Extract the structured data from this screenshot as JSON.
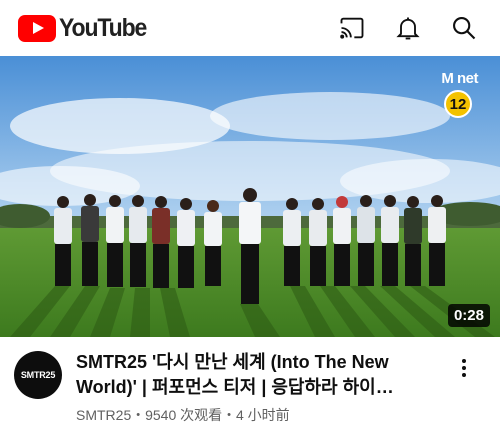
{
  "header": {
    "logo_text": "YouTube",
    "icons": [
      "cast-icon",
      "notifications-icon",
      "search-icon"
    ]
  },
  "video": {
    "channel_watermark": "M net",
    "age_rating": "12",
    "duration": "0:28"
  },
  "info": {
    "avatar_text": "SMTR25",
    "title_line1": "SMTR25 '다시 만난 세계 (Into The New",
    "title_line2": "World)' | 퍼포먼스 티저 | 응답하라 하이…",
    "channel": "SMTR25",
    "views": "9540 次观看",
    "age": "4 小时前"
  },
  "colors": {
    "brand_red": "#ff0000",
    "rating_yellow": "#f3c200",
    "meta_gray": "#606060"
  }
}
